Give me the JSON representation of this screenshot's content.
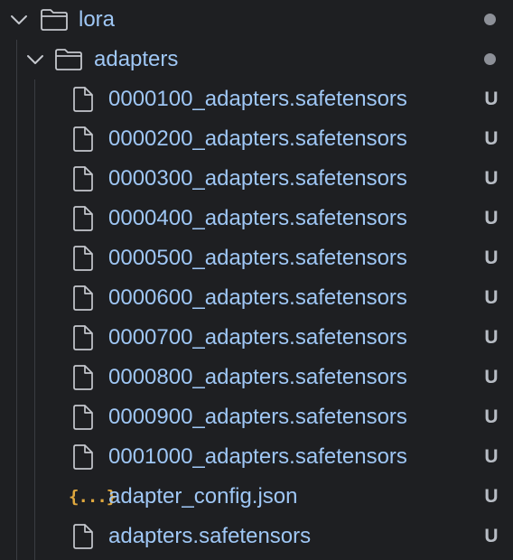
{
  "explorer": {
    "root": {
      "label": "lora",
      "expanded": true,
      "status": "dot",
      "icon": "folder-icon",
      "children": {
        "label": "adapters",
        "expanded": true,
        "status": "dot",
        "icon": "folder-icon",
        "files": [
          {
            "label": "0000100_adapters.safetensors",
            "badge": "U",
            "icon": "file-icon"
          },
          {
            "label": "0000200_adapters.safetensors",
            "badge": "U",
            "icon": "file-icon"
          },
          {
            "label": "0000300_adapters.safetensors",
            "badge": "U",
            "icon": "file-icon"
          },
          {
            "label": "0000400_adapters.safetensors",
            "badge": "U",
            "icon": "file-icon"
          },
          {
            "label": "0000500_adapters.safetensors",
            "badge": "U",
            "icon": "file-icon"
          },
          {
            "label": "0000600_adapters.safetensors",
            "badge": "U",
            "icon": "file-icon"
          },
          {
            "label": "0000700_adapters.safetensors",
            "badge": "U",
            "icon": "file-icon"
          },
          {
            "label": "0000800_adapters.safetensors",
            "badge": "U",
            "icon": "file-icon"
          },
          {
            "label": "0000900_adapters.safetensors",
            "badge": "U",
            "icon": "file-icon"
          },
          {
            "label": "0001000_adapters.safetensors",
            "badge": "U",
            "icon": "file-icon"
          },
          {
            "label": "adapter_config.json",
            "badge": "U",
            "icon": "json-icon",
            "icon_text": "{...}"
          },
          {
            "label": "adapters.safetensors",
            "badge": "U",
            "icon": "file-icon"
          }
        ]
      }
    }
  },
  "colors": {
    "background": "#1e1f22",
    "label": "#9fc7f5",
    "badge": "#b7bcc4",
    "json_icon": "#e0a83e",
    "dot": "#8d9098"
  }
}
